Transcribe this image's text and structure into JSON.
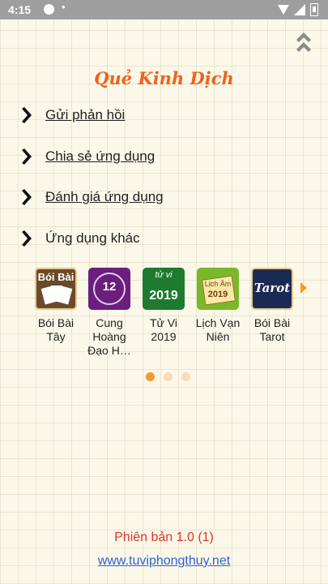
{
  "status_bar": {
    "time": "4:15",
    "notification_icons": "•"
  },
  "header": {
    "title": "Quẻ Kinh Dịch"
  },
  "menu": {
    "items": [
      {
        "label": "Gửi phản hồi"
      },
      {
        "label": "Chia sẻ ứng dụng"
      },
      {
        "label": "Đánh giá ứng dụng"
      },
      {
        "label": "Ứng dụng khác"
      }
    ]
  },
  "apps": {
    "items": [
      {
        "name_line1": "Bói Bài",
        "name_line2": "Tây",
        "name_line3": "",
        "icon_text": "Bói Bài"
      },
      {
        "name_line1": "Cung",
        "name_line2": "Hoàng",
        "name_line3": "Đạo H…",
        "icon_text": "12"
      },
      {
        "name_line1": "Tử Vi",
        "name_line2": "2019",
        "name_line3": "",
        "icon_text_top": "tử vi",
        "icon_text": "2019"
      },
      {
        "name_line1": "Lịch Vạn",
        "name_line2": "Niên",
        "name_line3": "",
        "icon_text_top": "Lịch Âm",
        "icon_text": "2019"
      },
      {
        "name_line1": "Bói Bài",
        "name_line2": "Tarot",
        "name_line3": "",
        "icon_text": "Tarot"
      }
    ],
    "page_count": 3,
    "active_page": 1
  },
  "footer": {
    "version": "Phiên bản 1.0 (1)",
    "website": "www.tuviphongthuy.net"
  },
  "colors": {
    "accent": "#f0621a",
    "dot_active": "#f39a2b",
    "dot_inactive": "#f7ddb8",
    "version_text": "#e0322d",
    "link": "#2a63d6"
  }
}
